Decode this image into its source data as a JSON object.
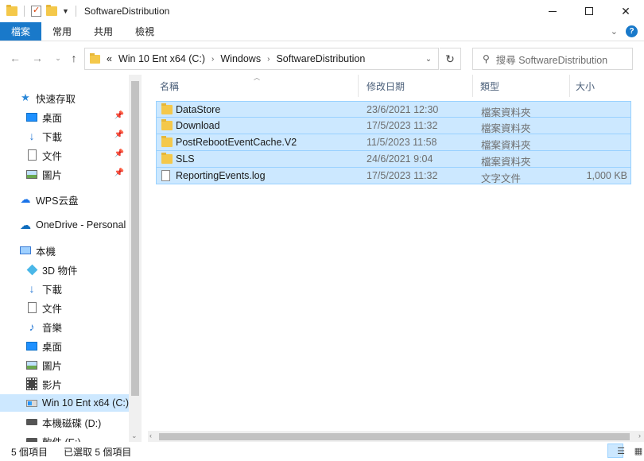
{
  "window": {
    "title": "SoftwareDistribution"
  },
  "ribbon": {
    "tabs": [
      "檔案",
      "常用",
      "共用",
      "檢視"
    ]
  },
  "address": {
    "overflow": "«",
    "crumbs": [
      "Win 10 Ent x64 (C:)",
      "Windows",
      "SoftwareDistribution"
    ]
  },
  "search": {
    "placeholder": "搜尋 SoftwareDistribution"
  },
  "sidebar": {
    "items": [
      {
        "label": "快速存取",
        "icon": "star-icon"
      },
      {
        "label": "桌面",
        "icon": "desktop-icon",
        "pinned": true
      },
      {
        "label": "下載",
        "icon": "download-arrow-icon",
        "pinned": true
      },
      {
        "label": "文件",
        "icon": "document-icon",
        "pinned": true
      },
      {
        "label": "圖片",
        "icon": "pictures-icon",
        "pinned": true
      },
      {
        "label": "WPS云盘",
        "icon": "cloud-icon"
      },
      {
        "label": "OneDrive - Personal",
        "icon": "onedrive-icon"
      },
      {
        "label": "本機",
        "icon": "this-pc-icon"
      },
      {
        "label": "3D 物件",
        "icon": "3d-objects-icon"
      },
      {
        "label": "下載",
        "icon": "download-arrow-icon"
      },
      {
        "label": "文件",
        "icon": "document-icon"
      },
      {
        "label": "音樂",
        "icon": "music-note-icon"
      },
      {
        "label": "桌面",
        "icon": "desktop-icon"
      },
      {
        "label": "圖片",
        "icon": "pictures-icon"
      },
      {
        "label": "影片",
        "icon": "video-icon"
      },
      {
        "label": "Win 10 Ent x64 (C:)",
        "icon": "windows-drive-icon",
        "selected": true
      },
      {
        "label": "本機磁碟 (D:)",
        "icon": "drive-icon"
      },
      {
        "label": "軟件 (E:)",
        "icon": "drive-icon"
      }
    ]
  },
  "columns": {
    "name": "名稱",
    "date": "修改日期",
    "type": "類型",
    "size": "大小"
  },
  "files": [
    {
      "name": "DataStore",
      "date": "23/6/2021 12:30",
      "type": "檔案資料夾",
      "size": "",
      "kind": "folder"
    },
    {
      "name": "Download",
      "date": "17/5/2023 11:32",
      "type": "檔案資料夾",
      "size": "",
      "kind": "folder"
    },
    {
      "name": "PostRebootEventCache.V2",
      "date": "11/5/2023 11:58",
      "type": "檔案資料夾",
      "size": "",
      "kind": "folder"
    },
    {
      "name": "SLS",
      "date": "24/6/2021 9:04",
      "type": "檔案資料夾",
      "size": "",
      "kind": "folder"
    },
    {
      "name": "ReportingEvents.log",
      "date": "17/5/2023 11:32",
      "type": "文字文件",
      "size": "1,000 KB",
      "kind": "file"
    }
  ],
  "status": {
    "count": "5 個項目",
    "selected": "已選取 5 個項目"
  },
  "colors": {
    "accent": "#1979ca",
    "selection": "#cce8ff",
    "selection_border": "#99d1ff",
    "folder": "#f4c84a"
  }
}
